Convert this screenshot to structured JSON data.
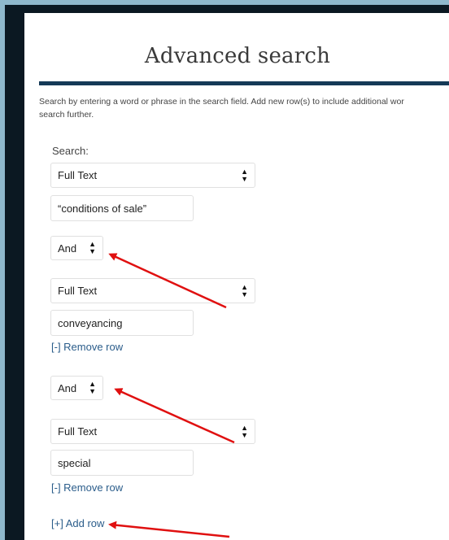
{
  "page": {
    "title": "Advanced search",
    "instructions_line1": "Search by entering a word or phrase in the search field. Add new row(s) to include additional wor",
    "instructions_line2": "search further.",
    "search_label": "Search:"
  },
  "rows": [
    {
      "field": "Full Text",
      "value": "“conditions of sale”"
    },
    {
      "operator": "And",
      "field": "Full Text",
      "value": "conveyancing",
      "remove_label": "[-] Remove row"
    },
    {
      "operator": "And",
      "field": "Full Text",
      "value": "special",
      "remove_label": "[-] Remove row"
    }
  ],
  "add_row_label": "[+] Add row",
  "icons": {
    "select_caret": "up-down-caret-icon",
    "annotation": "red-arrow-icon"
  },
  "colors": {
    "heading_rule": "#153a57",
    "link": "#2a5c8a",
    "annotation_arrow": "#e01010",
    "background": "#8fb8cc"
  }
}
